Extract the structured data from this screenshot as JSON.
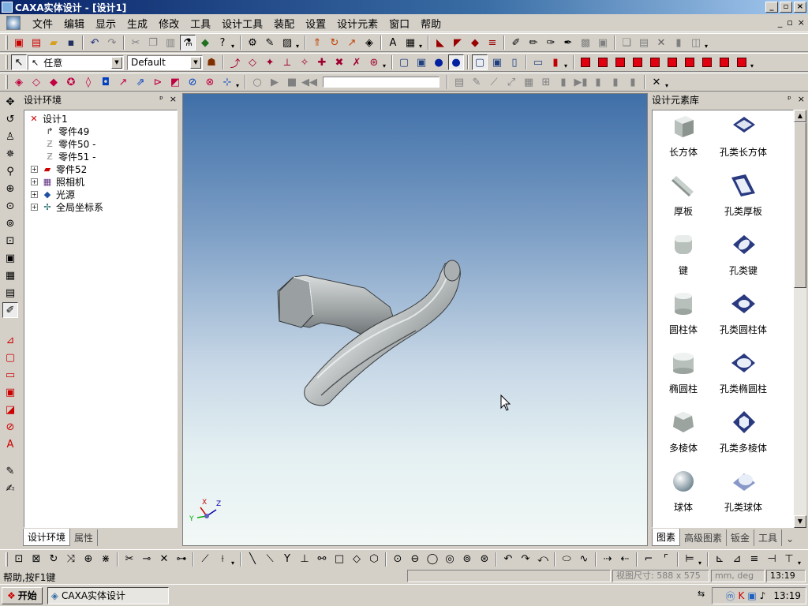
{
  "window": {
    "title": "CAXA实体设计 - [设计1]"
  },
  "menu": [
    "文件",
    "编辑",
    "显示",
    "生成",
    "修改",
    "工具",
    "设计工具",
    "装配",
    "设置",
    "设计元素",
    "窗口",
    "帮助"
  ],
  "toolbar": {
    "select_mode": "任意",
    "style_combo": "Default"
  },
  "left_panel": {
    "title": "设计环境",
    "tree": [
      {
        "label": "设计1",
        "icon": "design-icon"
      },
      {
        "label": "零件49",
        "icon": "part-icon"
      },
      {
        "label": "零件50 -",
        "icon": "part-hidden-icon"
      },
      {
        "label": "零件51 -",
        "icon": "part-hidden-icon"
      },
      {
        "label": "零件52",
        "icon": "part-solid-icon"
      },
      {
        "label": "照相机",
        "icon": "camera-icon"
      },
      {
        "label": "光源",
        "icon": "light-icon"
      },
      {
        "label": "全局坐标系",
        "icon": "coordinate-icon"
      }
    ],
    "tabs": [
      "设计环境",
      "属性"
    ]
  },
  "right_panel": {
    "title": "设计元素库",
    "items": [
      {
        "label": "长方体",
        "icon": "box-icon"
      },
      {
        "label": "孔类长方体",
        "icon": "box-hole-icon"
      },
      {
        "label": "厚板",
        "icon": "plate-icon"
      },
      {
        "label": "孔类厚板",
        "icon": "plate-hole-icon"
      },
      {
        "label": "键",
        "icon": "key-icon"
      },
      {
        "label": "孔类键",
        "icon": "key-hole-icon"
      },
      {
        "label": "圆柱体",
        "icon": "cylinder-icon"
      },
      {
        "label": "孔类圆柱体",
        "icon": "cylinder-hole-icon"
      },
      {
        "label": "椭圆柱",
        "icon": "ellipse-cylinder-icon"
      },
      {
        "label": "孔类椭圆柱",
        "icon": "ellipse-cylinder-hole-icon"
      },
      {
        "label": "多棱体",
        "icon": "polygon-prism-icon"
      },
      {
        "label": "孔类多棱体",
        "icon": "polygon-prism-hole-icon"
      },
      {
        "label": "球体",
        "icon": "sphere-icon"
      },
      {
        "label": "孔类球体",
        "icon": "sphere-hole-icon"
      }
    ],
    "tabs": [
      "图素",
      "高级图素",
      "钣金",
      "工具"
    ]
  },
  "viewport": {
    "axis_x": "X",
    "axis_y": "Y",
    "axis_z": "Z"
  },
  "status": {
    "help": "帮助,按F1键",
    "view_size": "视图尺寸: 588 x 575",
    "units": "mm, deg",
    "time": "13:19"
  },
  "taskbar": {
    "start": "开始",
    "task": "CAXA实体设计",
    "clock": "13:19"
  }
}
